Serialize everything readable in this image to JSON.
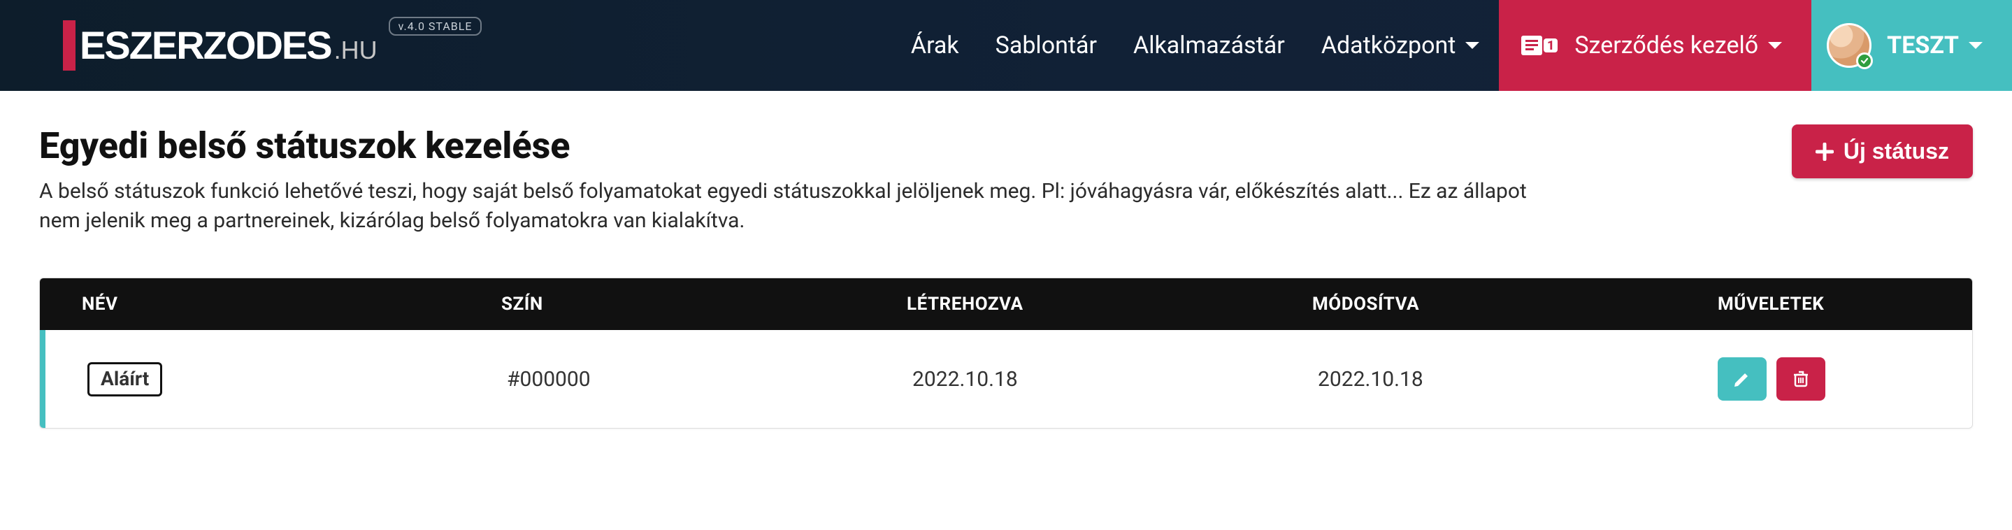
{
  "brand": {
    "name_main": "ESZERZODES",
    "name_suffix": ".HU",
    "version": "v.4.0 STABLE"
  },
  "nav": {
    "items": [
      {
        "label": "Árak",
        "has_dropdown": false
      },
      {
        "label": "Sablontár",
        "has_dropdown": false
      },
      {
        "label": "Alkalmazástár",
        "has_dropdown": false
      },
      {
        "label": "Adatközpont",
        "has_dropdown": true
      }
    ],
    "manager": {
      "label": "Szerződés kezelő",
      "badge": "1"
    },
    "user": {
      "name": "TESZT"
    }
  },
  "page": {
    "title": "Egyedi belső státuszok kezelése",
    "description": "A belső státuszok funkció lehetővé teszi, hogy saját belső folyamatokat egyedi státuszokkal jelöljenek meg. Pl: jóváhagyásra vár, előkészítés alatt... Ez az állapot nem jelenik meg a partnereinek, kizárólag belső folyamatokra van kialakítva.",
    "new_button": "Új státusz"
  },
  "table": {
    "headers": {
      "name": "NÉV",
      "color": "SZÍN",
      "created": "LÉTREHOZVA",
      "modified": "MÓDOSÍTVA",
      "actions": "MŰVELETEK"
    },
    "rows": [
      {
        "name": "Aláírt",
        "color": "#000000",
        "created": "2022.10.18",
        "modified": "2022.10.18"
      }
    ]
  },
  "icons": {
    "chevron_down": "chevron-down-icon",
    "plus": "plus-icon",
    "document": "document-badge-icon",
    "pencil": "pencil-icon",
    "trash": "trash-icon",
    "user_check": "user-check-icon"
  }
}
